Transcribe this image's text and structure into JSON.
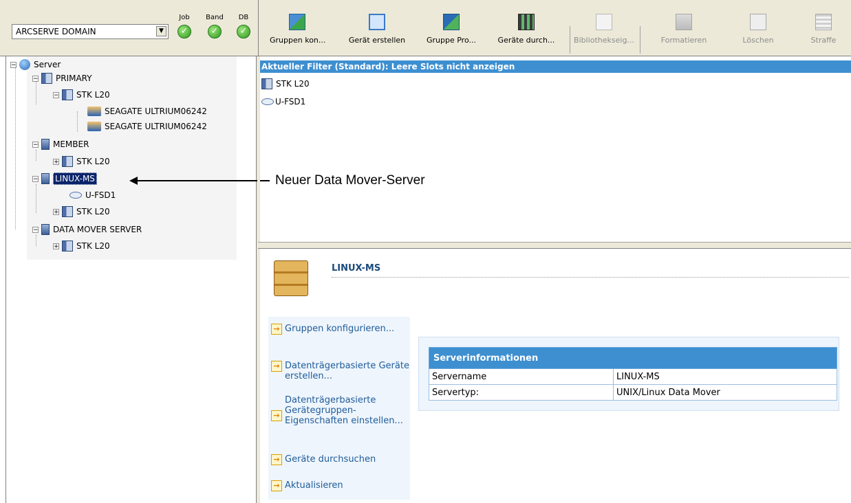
{
  "domain_selector": {
    "value": "ARCSERVE DOMAIN"
  },
  "status_indicators": [
    {
      "label": "Job",
      "status": "ok"
    },
    {
      "label": "Band",
      "status": "ok"
    },
    {
      "label": "DB",
      "status": "ok"
    }
  ],
  "toolbar": {
    "buttons": [
      {
        "label": "Gruppen kon...",
        "enabled": true
      },
      {
        "label": "Gerät erstellen",
        "enabled": true
      },
      {
        "label": "Gruppe Pro...",
        "enabled": true
      },
      {
        "label": "Geräte durch...",
        "enabled": true
      },
      {
        "label": "Bibliothekseig...",
        "enabled": false
      },
      {
        "label": "Formatieren",
        "enabled": false
      },
      {
        "label": "Löschen",
        "enabled": false
      },
      {
        "label": "Straffe",
        "enabled": false
      }
    ]
  },
  "tree": {
    "root": "Server",
    "nodes": [
      {
        "label": "PRIMARY"
      },
      {
        "label": "STK L20"
      },
      {
        "label": "SEAGATE ULTRIUM06242"
      },
      {
        "label": "SEAGATE ULTRIUM06242"
      },
      {
        "label": "MEMBER"
      },
      {
        "label": "STK L20"
      },
      {
        "label": "LINUX-MS"
      },
      {
        "label": "U-FSD1"
      },
      {
        "label": "STK L20"
      },
      {
        "label": "DATA MOVER SERVER"
      },
      {
        "label": "STK L20"
      }
    ]
  },
  "annotation": {
    "text": "Neuer Data Mover-Server"
  },
  "filter_bar": {
    "text": "Aktueller Filter (Standard): Leere Slots nicht anzeigen"
  },
  "device_list": [
    {
      "label": "STK L20"
    },
    {
      "label": "U-FSD1"
    }
  ],
  "details": {
    "title": "LINUX-MS",
    "tasks": [
      {
        "label": "Gruppen konfigurieren..."
      },
      {
        "label": "Datenträgerbasierte Geräte erstellen..."
      },
      {
        "label": "Datenträgerbasierte Gerätegruppen-Eigenschaften einstellen..."
      },
      {
        "label": "Geräte durchsuchen"
      },
      {
        "label": "Aktualisieren"
      }
    ],
    "info_table": {
      "header": "Serverinformationen",
      "rows": [
        {
          "key": "Servername",
          "value": "LINUX-MS"
        },
        {
          "key": "Servertyp:",
          "value": "UNIX/Linux Data Mover"
        }
      ]
    }
  },
  "colors": {
    "accent_blue": "#3d8fd0",
    "selection": "#0a246a",
    "task_link": "#1f5c9a"
  }
}
